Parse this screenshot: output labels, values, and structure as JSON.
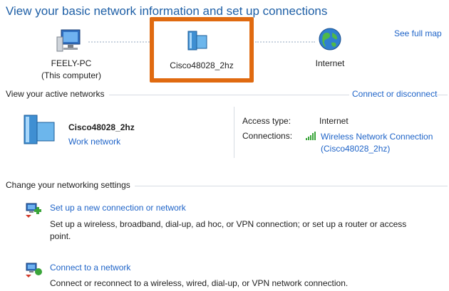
{
  "page_title": "View your basic network information and set up connections",
  "see_full_map": "See full map",
  "map": {
    "computer_name": "FEELY-PC",
    "computer_sub": "(This computer)",
    "network_name": "Cisco48028_2hz",
    "internet": "Internet"
  },
  "active_networks": {
    "label": "View your active networks",
    "connect_disconnect": "Connect or disconnect",
    "network_name": "Cisco48028_2hz",
    "network_type": "Work network",
    "access_type_label": "Access type:",
    "access_type_value": "Internet",
    "connections_label": "Connections:",
    "connection_link_line1": "Wireless Network Connection",
    "connection_link_line2": "(Cisco48028_2hz)"
  },
  "settings": {
    "label": "Change your networking settings",
    "items": [
      {
        "title": "Set up a new connection or network",
        "desc_line1": "Set up a wireless, broadband, dial-up, ad hoc, or VPN connection; or set up a router or access",
        "desc_line2": "point."
      },
      {
        "title": "Connect to a network",
        "desc_line1": "Connect or reconnect to a wireless, wired, dial-up, or VPN network connection."
      }
    ]
  },
  "colors": {
    "accent_link": "#1f64c8",
    "title_blue": "#1e5fa6",
    "highlight_orange": "#e06a10"
  }
}
